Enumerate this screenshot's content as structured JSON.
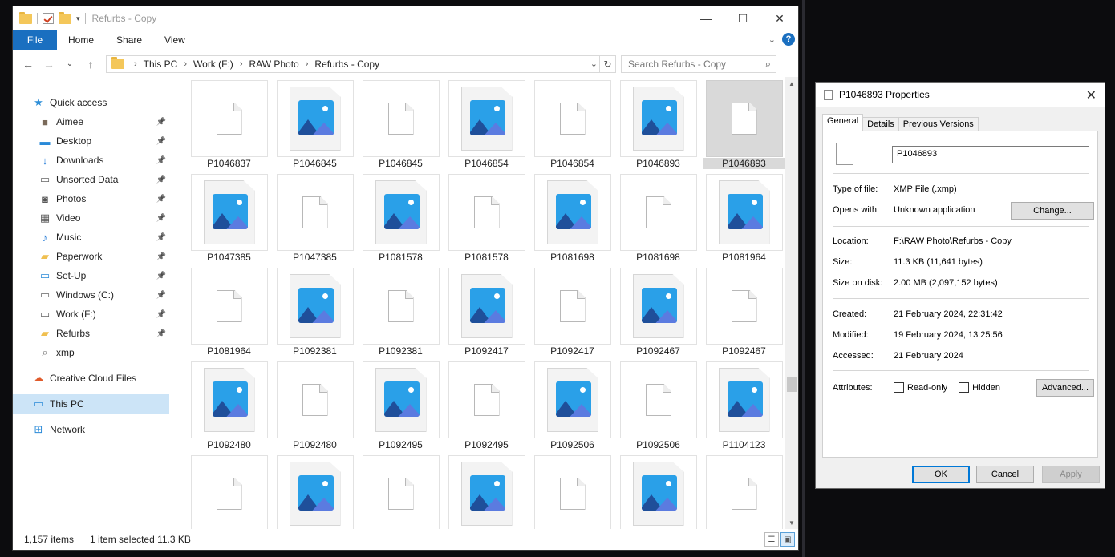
{
  "explorer": {
    "title": "Refurbs - Copy",
    "ribbon_tabs": [
      "File",
      "Home",
      "Share",
      "View"
    ],
    "breadcrumb": [
      "This PC",
      "Work (F:)",
      "RAW Photo",
      "Refurbs - Copy"
    ],
    "search_placeholder": "Search Refurbs - Copy",
    "sidebar": [
      {
        "label": "Quick access",
        "icon": "star-icon",
        "level": "top",
        "pinned": false
      },
      {
        "label": "Aimee",
        "icon": "user-folder-icon",
        "level": "sub",
        "pinned": true
      },
      {
        "label": "Desktop",
        "icon": "desktop-icon",
        "level": "sub",
        "pinned": true
      },
      {
        "label": "Downloads",
        "icon": "download-icon",
        "level": "sub",
        "pinned": true
      },
      {
        "label": "Unsorted Data",
        "icon": "drive-icon",
        "level": "sub",
        "pinned": true
      },
      {
        "label": "Photos",
        "icon": "camera-icon",
        "level": "sub",
        "pinned": true
      },
      {
        "label": "Video",
        "icon": "film-icon",
        "level": "sub",
        "pinned": true
      },
      {
        "label": "Music",
        "icon": "music-icon",
        "level": "sub",
        "pinned": true
      },
      {
        "label": "Paperwork",
        "icon": "folder-icon",
        "level": "sub",
        "pinned": true
      },
      {
        "label": "Set-Up",
        "icon": "monitor-icon",
        "level": "sub",
        "pinned": true
      },
      {
        "label": "Windows (C:)",
        "icon": "drive-icon",
        "level": "sub",
        "pinned": true
      },
      {
        "label": "Work (F:)",
        "icon": "drive-icon",
        "level": "sub",
        "pinned": true
      },
      {
        "label": "Refurbs",
        "icon": "folder-icon",
        "level": "sub",
        "pinned": true
      },
      {
        "label": "xmp",
        "icon": "search-icon",
        "level": "sub",
        "pinned": false
      },
      {
        "label": "Creative Cloud Files",
        "icon": "cloud-folder-icon",
        "level": "top",
        "pinned": false,
        "gap": true
      },
      {
        "label": "This PC",
        "icon": "computer-icon",
        "level": "top",
        "pinned": false,
        "gap": true,
        "selected": true
      },
      {
        "label": "Network",
        "icon": "network-icon",
        "level": "top",
        "pinned": false,
        "gap": true
      }
    ],
    "files": [
      {
        "name": "P1046837",
        "kind": "doc"
      },
      {
        "name": "P1046845",
        "kind": "photo"
      },
      {
        "name": "P1046845",
        "kind": "doc"
      },
      {
        "name": "P1046854",
        "kind": "photo"
      },
      {
        "name": "P1046854",
        "kind": "doc"
      },
      {
        "name": "P1046893",
        "kind": "photo"
      },
      {
        "name": "P1046893",
        "kind": "doc",
        "selected": true
      },
      {
        "name": "P1047385",
        "kind": "photo"
      },
      {
        "name": "P1047385",
        "kind": "doc"
      },
      {
        "name": "P1081578",
        "kind": "photo"
      },
      {
        "name": "P1081578",
        "kind": "doc"
      },
      {
        "name": "P1081698",
        "kind": "photo"
      },
      {
        "name": "P1081698",
        "kind": "doc"
      },
      {
        "name": "P1081964",
        "kind": "photo"
      },
      {
        "name": "P1081964",
        "kind": "doc"
      },
      {
        "name": "P1092381",
        "kind": "photo"
      },
      {
        "name": "P1092381",
        "kind": "doc"
      },
      {
        "name": "P1092417",
        "kind": "photo"
      },
      {
        "name": "P1092417",
        "kind": "doc"
      },
      {
        "name": "P1092467",
        "kind": "photo"
      },
      {
        "name": "P1092467",
        "kind": "doc"
      },
      {
        "name": "P1092480",
        "kind": "photo"
      },
      {
        "name": "P1092480",
        "kind": "doc"
      },
      {
        "name": "P1092495",
        "kind": "photo"
      },
      {
        "name": "P1092495",
        "kind": "doc"
      },
      {
        "name": "P1092506",
        "kind": "photo"
      },
      {
        "name": "P1092506",
        "kind": "doc"
      },
      {
        "name": "P1104123",
        "kind": "photo"
      },
      {
        "name": "",
        "kind": "doc"
      },
      {
        "name": "",
        "kind": "photo"
      },
      {
        "name": "",
        "kind": "doc"
      },
      {
        "name": "",
        "kind": "photo"
      },
      {
        "name": "",
        "kind": "doc"
      },
      {
        "name": "",
        "kind": "photo"
      },
      {
        "name": "",
        "kind": "doc"
      }
    ],
    "status": {
      "count": "1,157 items",
      "selected": "1 item selected  11.3 KB"
    }
  },
  "props": {
    "title": "P1046893 Properties",
    "tabs": [
      "General",
      "Details",
      "Previous Versions"
    ],
    "filename": "P1046893",
    "type_label": "Type of file:",
    "type_value": "XMP File (.xmp)",
    "opens_label": "Opens with:",
    "opens_value": "Unknown application",
    "change_btn": "Change...",
    "location_label": "Location:",
    "location_value": "F:\\RAW Photo\\Refurbs - Copy",
    "size_label": "Size:",
    "size_value": "11.3 KB (11,641 bytes)",
    "disk_label": "Size on disk:",
    "disk_value": "2.00 MB (2,097,152 bytes)",
    "created_label": "Created:",
    "created_value": "21 February 2024, 22:31:42",
    "modified_label": "Modified:",
    "modified_value": "19 February 2024, 13:25:56",
    "accessed_label": "Accessed:",
    "accessed_value": "21 February 2024",
    "attributes_label": "Attributes:",
    "readonly_label": "Read-only",
    "hidden_label": "Hidden",
    "advanced_btn": "Advanced...",
    "ok_btn": "OK",
    "cancel_btn": "Cancel",
    "apply_btn": "Apply"
  }
}
